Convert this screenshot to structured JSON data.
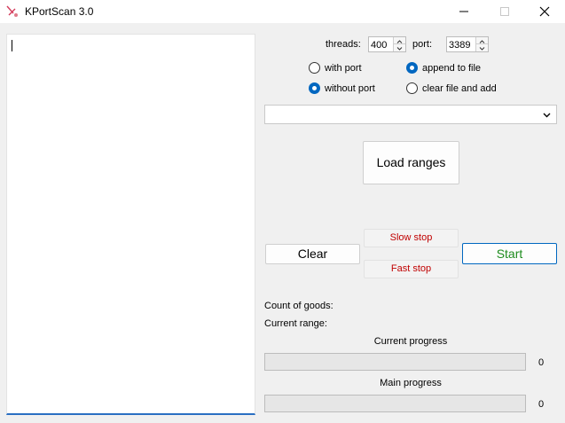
{
  "window": {
    "title": "KPortScan 3.0",
    "minimize_icon": "minimize-icon",
    "maximize_icon": "maximize-icon",
    "close_icon": "close-icon"
  },
  "settings": {
    "threads_label": "threads:",
    "threads_value": "400",
    "port_label": "port:",
    "port_value": "3389"
  },
  "options": {
    "with_port": "with port",
    "without_port": "without port",
    "append_to_file": "append to file",
    "clear_file_and_add": "clear file and add",
    "selected_port_mode": "without port",
    "selected_file_mode": "append to file"
  },
  "ranges_combo": {
    "value": ""
  },
  "buttons": {
    "load_ranges": "Load ranges",
    "clear": "Clear",
    "slow_stop": "Slow stop",
    "fast_stop": "Fast stop",
    "start": "Start"
  },
  "status": {
    "count_of_goods_label": "Count of goods:",
    "current_range_label": "Current range:"
  },
  "progress": {
    "current_title": "Current progress",
    "current_value": "0",
    "current_fraction": 0,
    "main_title": "Main progress",
    "main_value": "0",
    "main_fraction": 0
  },
  "colors": {
    "accent": "#0067c0",
    "stop_text": "#c00000",
    "start_text": "#1e8c1e"
  }
}
